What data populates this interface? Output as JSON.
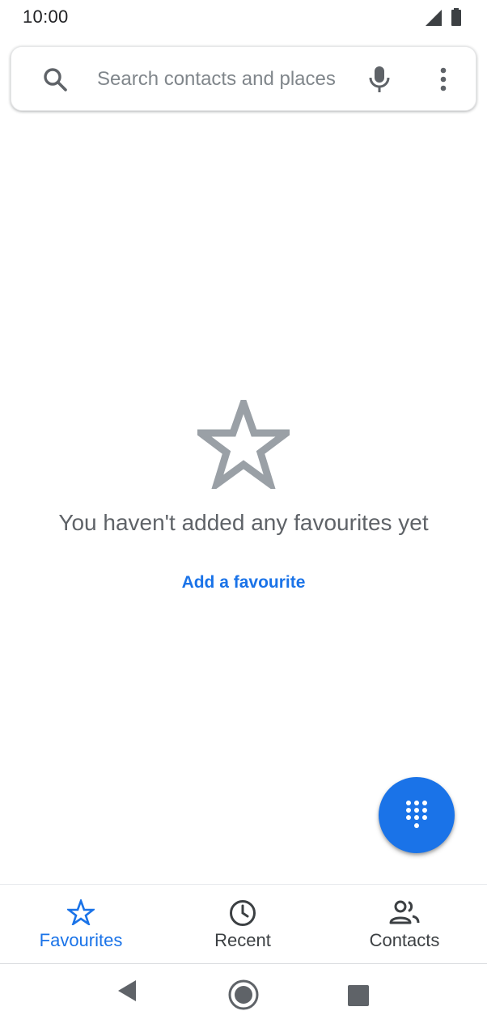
{
  "status_bar": {
    "time": "10:00",
    "icons": [
      "signal-icon",
      "battery-icon"
    ]
  },
  "search": {
    "placeholder": "Search contacts and places",
    "value": "",
    "icons": [
      "search-icon",
      "mic-icon",
      "more-vert-icon"
    ]
  },
  "empty_state": {
    "icon": "star-outline-icon",
    "message": "You haven't added any favourites yet",
    "action_label": "Add a favourite"
  },
  "fab": {
    "icon": "dialpad-icon"
  },
  "bottom_nav": {
    "items": [
      {
        "label": "Favourites",
        "icon": "star-outline-icon",
        "active": true
      },
      {
        "label": "Recent",
        "icon": "clock-icon",
        "active": false
      },
      {
        "label": "Contacts",
        "icon": "people-icon",
        "active": false
      }
    ]
  },
  "system_nav": {
    "icons": [
      "back-icon",
      "home-icon",
      "recents-icon"
    ]
  },
  "colors": {
    "accent": "#1a73e8",
    "icon_gray": "#5f6368",
    "empty_icon": "#9aa0a6",
    "text_secondary": "#5f6368"
  }
}
